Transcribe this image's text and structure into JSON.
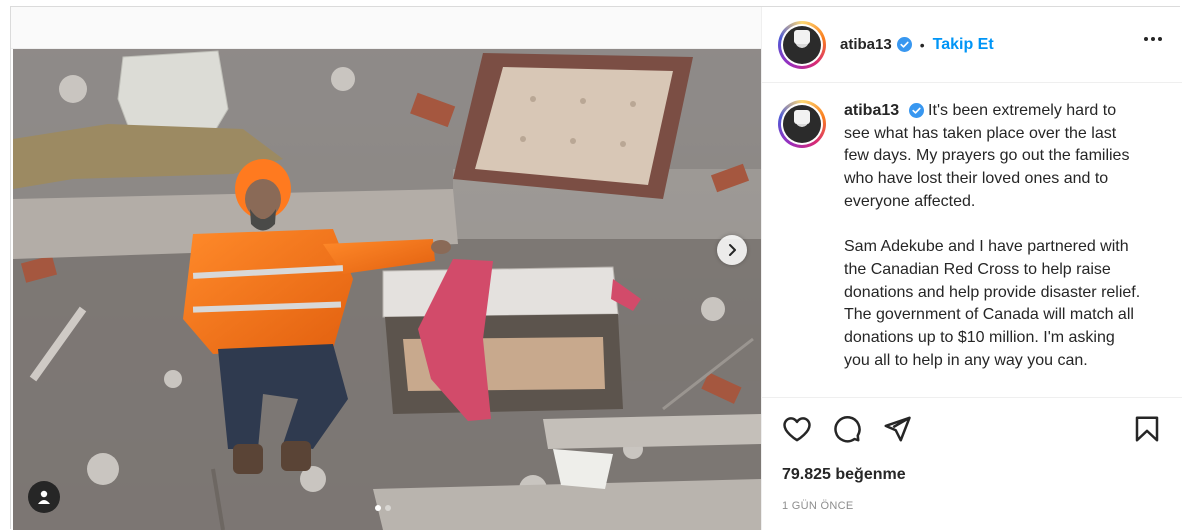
{
  "post": {
    "username": "atiba13",
    "follow_label": "Takip Et",
    "separator": "•",
    "caption_username": "atiba13",
    "caption_paragraphs": [
      "It's been extremely hard to see what has taken place over the last few days. My prayers go out the families who have lost their loved ones and to everyone affected.",
      "Sam Adekube and I have partnered with the Canadian Red Cross to help raise donations and help provide disaster relief. The government of Canada will match all donations up to $10 million. I'm asking you all to help in any way you can."
    ],
    "likes_text": "79.825 beğenme",
    "time_text": "1 GÜN ÖNCE"
  },
  "icons": {
    "like": "heart-icon",
    "comment": "comment-icon",
    "share": "send-icon",
    "save": "bookmark-icon",
    "more": "more-options-icon",
    "next": "chevron-right-icon",
    "tag": "user-tag-icon",
    "verified": "verified-badge-icon"
  },
  "carousel": {
    "total": 2,
    "current": 1
  },
  "colors": {
    "accent": "#0095f6",
    "verified": "#3897f0",
    "text": "#262626",
    "muted": "#8e8e8e"
  }
}
